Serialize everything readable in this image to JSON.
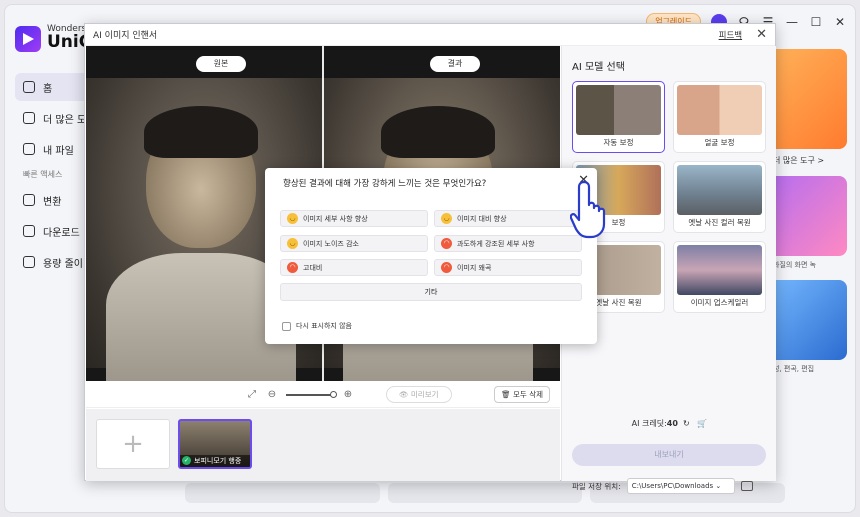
{
  "brand": {
    "top": "Wonders",
    "main": "UniCo"
  },
  "nav": {
    "items": [
      {
        "label": "홈"
      },
      {
        "label": "더 많은 도"
      },
      {
        "label": "내 파일"
      }
    ],
    "section": "빠른 액세스",
    "quick": [
      {
        "label": "변환"
      },
      {
        "label": "다운로드"
      },
      {
        "label": "용량 줄이"
      }
    ]
  },
  "topbar": {
    "upgrade": "업그레이드"
  },
  "right_panel": {
    "more_tools": "더 많은 도구 >",
    "caption1": "화질의 화면 녹",
    "caption2": "성, 편곡, 편집"
  },
  "dialog": {
    "title": "AI 이미지 인핸서",
    "feedback": "피드백",
    "tag_original": "원본",
    "tag_result": "결과",
    "preview": "미리보기",
    "delete_all": "모두 삭제",
    "thumb_caption": "보피니모기 행중",
    "side_title": "AI 모델 선택",
    "models": [
      {
        "label": "자동 보정"
      },
      {
        "label": "얼굴 보정"
      },
      {
        "label": "보정"
      },
      {
        "label": "옛날 사진 컬러 복원"
      },
      {
        "label": "옛날 사진 복원"
      },
      {
        "label": "이미지 업스케일러"
      }
    ],
    "credits_label": "AI 크레딧:",
    "credits_value": "40",
    "export": "내보내기",
    "save_label": "파일 저장 위치:",
    "save_path": "C:\\Users\\PC\\Downloads"
  },
  "survey": {
    "question": "향상된 결과에 대해 가장 강하게 느끼는 것은 무엇인가요?",
    "options": [
      {
        "label": "이미지 세부 사항 향상"
      },
      {
        "label": "이미지 대비 향상"
      },
      {
        "label": "이미지 노이즈 감소"
      },
      {
        "label": "과도하게 강조된 세부 사항"
      },
      {
        "label": "고대비"
      },
      {
        "label": "이미지 왜곡"
      }
    ],
    "other": "기타",
    "dont_show": "다시 표시하지 않음"
  },
  "colors": {
    "accent": "#6b4cf0",
    "upgrade": "#d26500"
  }
}
